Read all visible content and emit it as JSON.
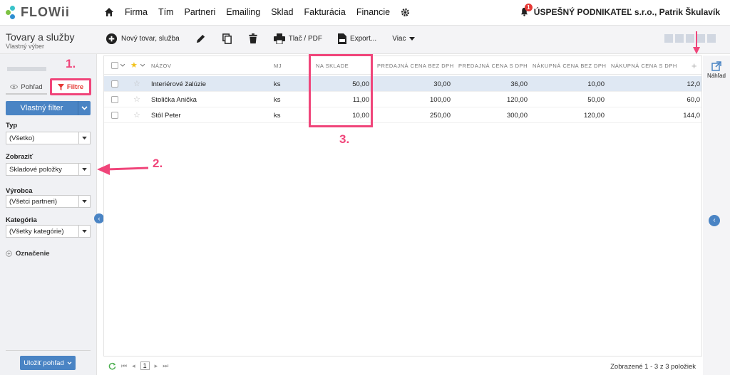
{
  "app": {
    "logo": "FLOWii",
    "nav": [
      "Firma",
      "Tím",
      "Partneri",
      "Emailing",
      "Sklad",
      "Fakturácia",
      "Financie"
    ],
    "notifications": "1",
    "user": "ÚSPEŠNÝ PODNIKATEĽ s.r.o., Patrik Škulavík"
  },
  "toolbar": {
    "title": "Tovary a služby",
    "subtitle": "Vlastný výber",
    "new_item": "Nový tovar, služba",
    "print": "Tlač / PDF",
    "export": "Export...",
    "more": "Viac"
  },
  "sidebar": {
    "view_tab": "Pohľad",
    "filters_tab": "Filtre",
    "custom_filter": "Vlastný filter",
    "filters": [
      {
        "label": "Typ",
        "value": "(Všetko)"
      },
      {
        "label": "Zobraziť",
        "value": "Skladové položky"
      },
      {
        "label": "Výrobca",
        "value": "(Všetci partneri)"
      },
      {
        "label": "Kategória",
        "value": "(Všetky kategórie)"
      }
    ],
    "tags": "Označenie",
    "save_view": "Uložiť pohľad"
  },
  "grid": {
    "columns": [
      "NÁZOV",
      "MJ",
      "NA SKLADE",
      "PREDAJNÁ CENA BEZ DPH",
      "PREDAJNÁ CENA S DPH",
      "NÁKUPNÁ CENA BEZ DPH",
      "NÁKUPNÁ CENA S DPH"
    ],
    "rows": [
      {
        "name": "Interiérové žalúzie",
        "unit": "ks",
        "stock": "50,00",
        "sell_net": "30,00",
        "sell_gross": "36,00",
        "buy_net": "10,00",
        "buy_gross": "12,0",
        "selected": true
      },
      {
        "name": "Stolička Anička",
        "unit": "ks",
        "stock": "11,00",
        "sell_net": "100,00",
        "sell_gross": "120,00",
        "buy_net": "50,00",
        "buy_gross": "60,0",
        "selected": false
      },
      {
        "name": "Stôl Peter",
        "unit": "ks",
        "stock": "10,00",
        "sell_net": "250,00",
        "sell_gross": "300,00",
        "buy_net": "120,00",
        "buy_gross": "144,0",
        "selected": false
      }
    ],
    "page": "1",
    "summary": "Zobrazené 1 - 3 z 3 položiek"
  },
  "right_panel": {
    "preview": "Náhľad"
  },
  "annotations": [
    "1.",
    "2.",
    "3."
  ],
  "colors": {
    "accent": "#4a84c4",
    "annotation": "#f0457a",
    "selected_row": "#dfe8f3"
  }
}
